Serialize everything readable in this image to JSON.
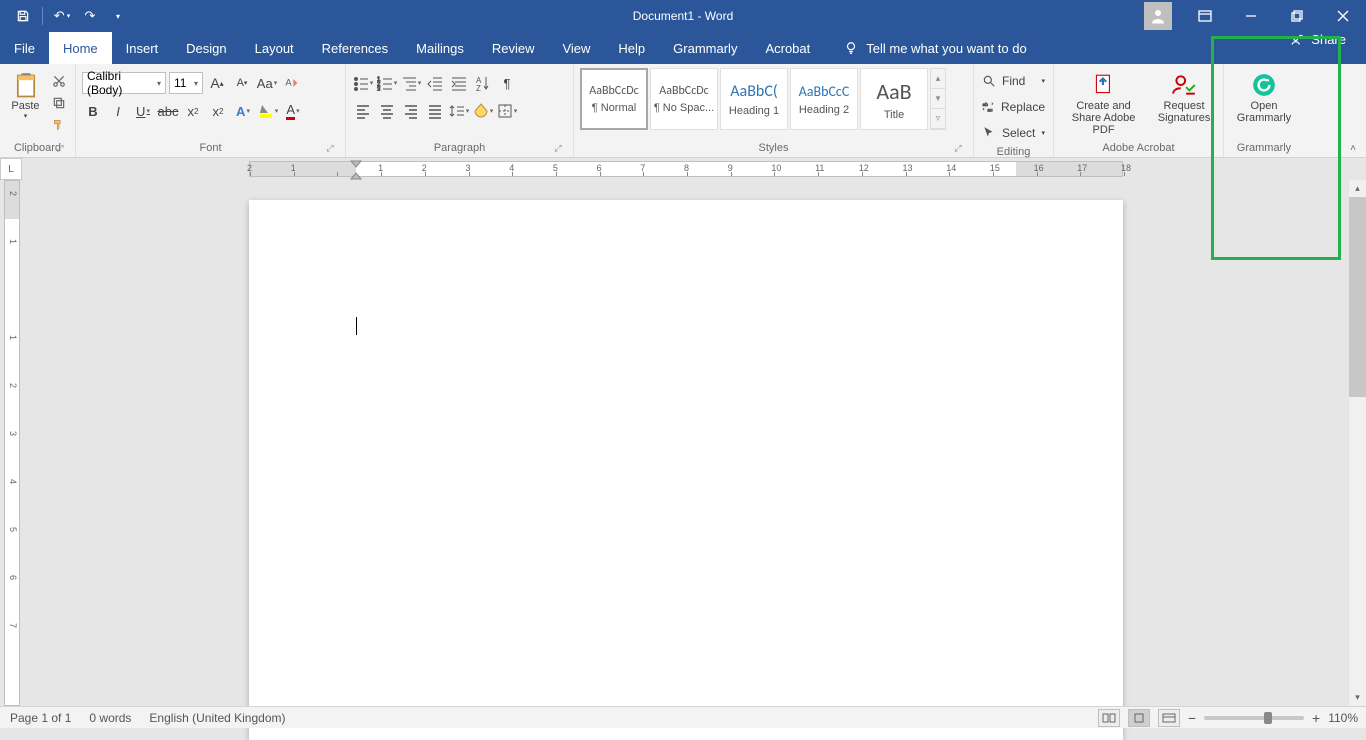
{
  "title": "Document1 - Word",
  "share": "Share",
  "tabs": [
    "File",
    "Home",
    "Insert",
    "Design",
    "Layout",
    "References",
    "Mailings",
    "Review",
    "View",
    "Help",
    "Grammarly",
    "Acrobat"
  ],
  "tell_me": "Tell me what you want to do",
  "clipboard": {
    "paste": "Paste",
    "label": "Clipboard"
  },
  "font": {
    "name": "Calibri (Body)",
    "size": "11",
    "label": "Font"
  },
  "paragraph": {
    "label": "Paragraph"
  },
  "styles": {
    "label": "Styles",
    "items": [
      {
        "preview": "AaBbCcDc",
        "name": "¶ Normal"
      },
      {
        "preview": "AaBbCcDc",
        "name": "¶ No Spac..."
      },
      {
        "preview": "AaBbC(",
        "name": "Heading 1"
      },
      {
        "preview": "AaBbCcC",
        "name": "Heading 2"
      },
      {
        "preview": "AaB",
        "name": "Title"
      }
    ]
  },
  "editing": {
    "find": "Find",
    "replace": "Replace",
    "select": "Select",
    "label": "Editing"
  },
  "acrobat": {
    "create": "Create and Share Adobe PDF",
    "request": "Request Signatures",
    "label": "Adobe Acrobat"
  },
  "grammarly": {
    "open": "Open Grammarly",
    "label": "Grammarly"
  },
  "ruler_numbers_h": [
    "2",
    "1",
    "",
    "1",
    "2",
    "3",
    "4",
    "5",
    "6",
    "7",
    "8",
    "9",
    "10",
    "11",
    "12",
    "13",
    "14",
    "15",
    "16",
    "17",
    "18"
  ],
  "ruler_numbers_v": [
    "2",
    "1",
    "",
    "1",
    "2",
    "3",
    "4",
    "5",
    "6",
    "7"
  ],
  "status": {
    "page": "Page 1 of 1",
    "words": "0 words",
    "lang": "English (United Kingdom)",
    "zoom": "110%"
  }
}
